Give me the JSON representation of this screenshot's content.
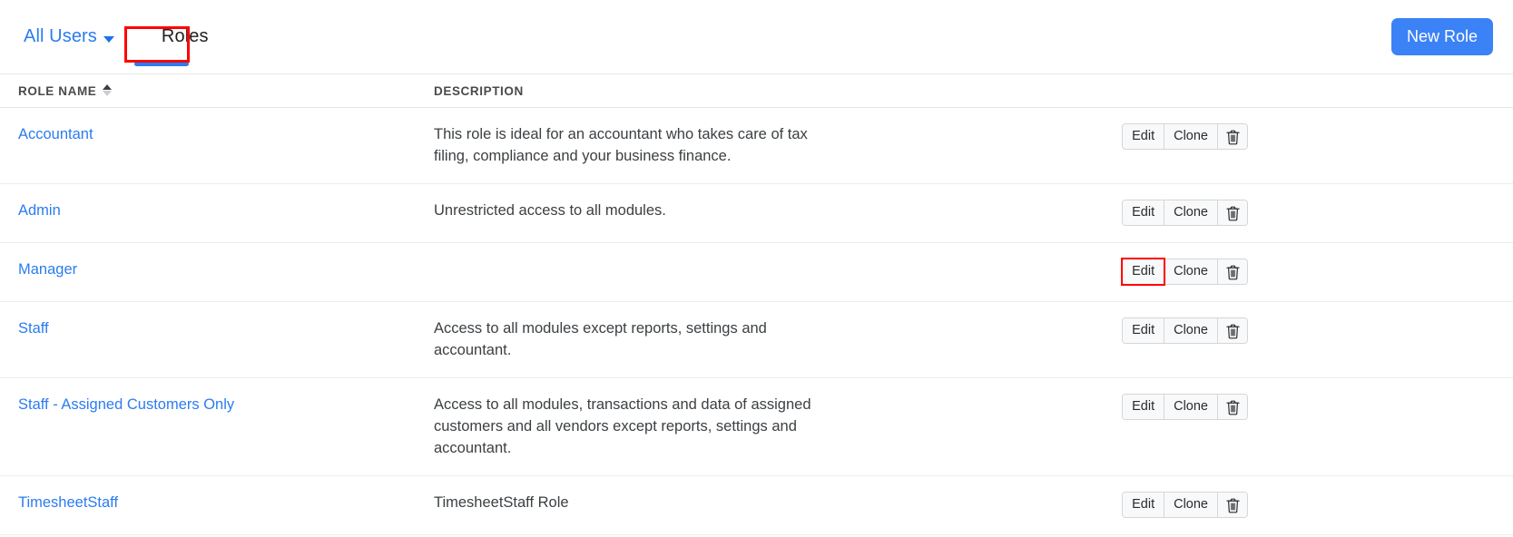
{
  "header": {
    "tabs": [
      {
        "label": "All Users",
        "icon": "chevron-down-icon",
        "active": false
      },
      {
        "label": "Roles",
        "active": true
      }
    ],
    "new_role_label": "New Role"
  },
  "table": {
    "columns": [
      {
        "key": "role_name",
        "label": "ROLE NAME",
        "sort": "ascending",
        "sort_icon": "sort-ascending-icon"
      },
      {
        "key": "description",
        "label": "DESCRIPTION"
      }
    ],
    "actions": {
      "edit_label": "Edit",
      "clone_label": "Clone",
      "delete_icon": "trash-icon"
    },
    "rows": [
      {
        "role_name": "Accountant",
        "description": "This role is ideal for an accountant who takes care of tax filing, compliance and your business finance.",
        "edit_highlighted": false
      },
      {
        "role_name": "Admin",
        "description": "Unrestricted access to all modules.",
        "edit_highlighted": false
      },
      {
        "role_name": "Manager",
        "description": "",
        "edit_highlighted": true
      },
      {
        "role_name": "Staff",
        "description": "Access to all modules except reports, settings and accountant.",
        "edit_highlighted": false
      },
      {
        "role_name": "Staff - Assigned Customers Only",
        "description": "Access to all modules, transactions and data of assigned customers and all vendors except reports, settings and accountant.",
        "edit_highlighted": false
      },
      {
        "role_name": "TimesheetStaff",
        "description": "TimesheetStaff Role",
        "edit_highlighted": false
      }
    ]
  },
  "colors": {
    "link_blue": "#2b7cf0",
    "button_blue": "#3b82f6",
    "annotation_red": "#ff0000",
    "text_dark": "#3c4043",
    "border_gray": "#ededed"
  }
}
